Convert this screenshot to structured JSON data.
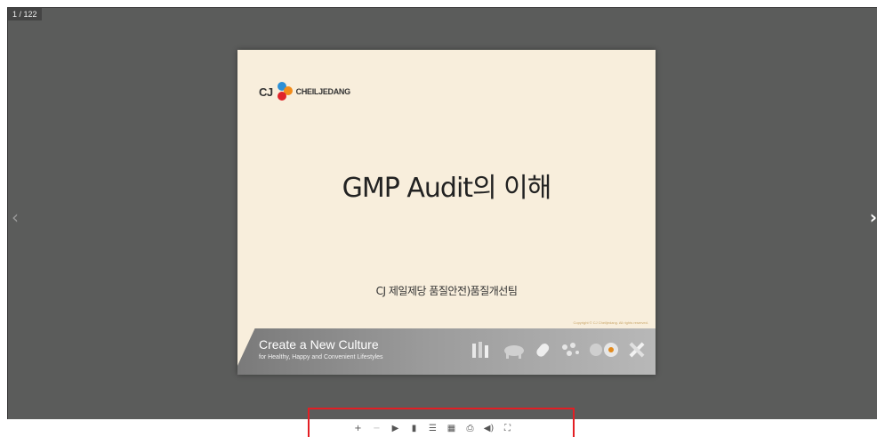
{
  "viewer": {
    "page_counter": "1 / 122",
    "prev_arrow": "‹",
    "next_arrow": "›"
  },
  "slide": {
    "logo_cj": "CJ",
    "logo_text": "CHEILJEDANG",
    "title": "GMP Audit의 이해",
    "subtitle": "CJ 제일제당 품질안전)품질개선팀",
    "copyright": "Copyright © CJ Cheiljedang. All rights reserved.",
    "banner_headline": "Create a New Culture",
    "banner_tagline": "for Healthy, Happy and Convenient Lifestyles"
  },
  "toolbar": {
    "zoom_in": "+",
    "zoom_out": "−",
    "play": "▶",
    "bookmark": "▮",
    "list": "☰",
    "grid": "▦",
    "print": "⎙",
    "sound": "◀)",
    "fullscreen": "⛶"
  },
  "colors": {
    "viewer_bg": "#5b5c5b",
    "slide_bg": "#f8eedc",
    "highlight_box": "#e31e24"
  }
}
